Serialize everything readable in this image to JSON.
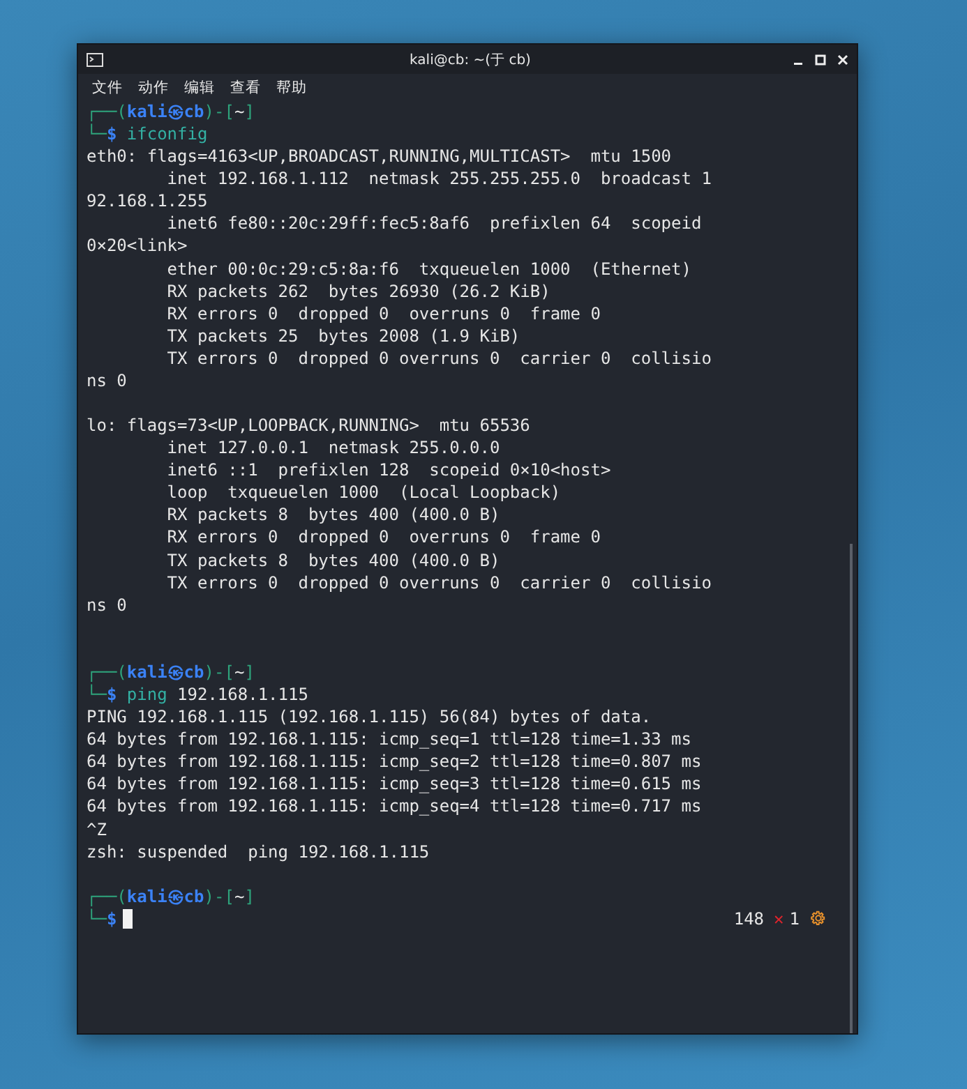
{
  "window": {
    "title": "kali@cb: ~(于 cb)"
  },
  "menu": [
    {
      "label": "文件"
    },
    {
      "label": "动作"
    },
    {
      "label": "编辑"
    },
    {
      "label": "查看"
    },
    {
      "label": "帮助"
    }
  ],
  "terminal": {
    "lines": [
      {
        "kind": "prompt",
        "segments": [
          {
            "kind": "frame",
            "text": "┌──("
          },
          {
            "kind": "user",
            "text": "kali㉿cb"
          },
          {
            "kind": "frame",
            "text": ")-["
          },
          {
            "kind": "plain",
            "text": "~"
          },
          {
            "kind": "frame",
            "text": "]"
          }
        ]
      },
      {
        "kind": "prompt",
        "segments": [
          {
            "kind": "frame",
            "text": "└─"
          },
          {
            "kind": "user",
            "text": "$"
          },
          {
            "kind": "command",
            "text": "ifconfig"
          }
        ]
      },
      {
        "kind": "output",
        "text": "eth0: flags=4163<UP,BROADCAST,RUNNING,MULTICAST>  mtu 1500"
      },
      {
        "kind": "output",
        "text": "        inet 192.168.1.112  netmask 255.255.255.0  broadcast 1"
      },
      {
        "kind": "output",
        "text": "92.168.1.255"
      },
      {
        "kind": "output",
        "text": "        inet6 fe80::20c:29ff:fec5:8af6  prefixlen 64  scopeid"
      },
      {
        "kind": "output",
        "text": "0×20<link>"
      },
      {
        "kind": "output",
        "text": "        ether 00:0c:29:c5:8a:f6  txqueuelen 1000  (Ethernet)"
      },
      {
        "kind": "output",
        "text": "        RX packets 262  bytes 26930 (26.2 KiB)"
      },
      {
        "kind": "output",
        "text": "        RX errors 0  dropped 0  overruns 0  frame 0"
      },
      {
        "kind": "output",
        "text": "        TX packets 25  bytes 2008 (1.9 KiB)"
      },
      {
        "kind": "output",
        "text": "        TX errors 0  dropped 0 overruns 0  carrier 0  collisio"
      },
      {
        "kind": "output",
        "text": "ns 0"
      },
      {
        "kind": "blank"
      },
      {
        "kind": "output",
        "text": "lo: flags=73<UP,LOOPBACK,RUNNING>  mtu 65536"
      },
      {
        "kind": "output",
        "text": "        inet 127.0.0.1  netmask 255.0.0.0"
      },
      {
        "kind": "output",
        "text": "        inet6 ::1  prefixlen 128  scopeid 0×10<host>"
      },
      {
        "kind": "output",
        "text": "        loop  txqueuelen 1000  (Local Loopback)"
      },
      {
        "kind": "output",
        "text": "        RX packets 8  bytes 400 (400.0 B)"
      },
      {
        "kind": "output",
        "text": "        RX errors 0  dropped 0  overruns 0  frame 0"
      },
      {
        "kind": "output",
        "text": "        TX packets 8  bytes 400 (400.0 B)"
      },
      {
        "kind": "output",
        "text": "        TX errors 0  dropped 0 overruns 0  carrier 0  collisio"
      },
      {
        "kind": "output",
        "text": "ns 0"
      },
      {
        "kind": "blank"
      },
      {
        "kind": "blank"
      },
      {
        "kind": "prompt",
        "segments": [
          {
            "kind": "frame",
            "text": "┌──("
          },
          {
            "kind": "user",
            "text": "kali㉿cb"
          },
          {
            "kind": "frame",
            "text": ")-["
          },
          {
            "kind": "plain",
            "text": "~"
          },
          {
            "kind": "frame",
            "text": "]"
          }
        ]
      },
      {
        "kind": "prompt",
        "segments": [
          {
            "kind": "frame",
            "text": "└─"
          },
          {
            "kind": "user",
            "text": "$"
          },
          {
            "kind": "command",
            "text": "ping"
          },
          {
            "kind": "arg",
            "text": "192.168.1.115"
          }
        ]
      },
      {
        "kind": "output",
        "text": "PING 192.168.1.115 (192.168.1.115) 56(84) bytes of data."
      },
      {
        "kind": "output",
        "text": "64 bytes from 192.168.1.115: icmp_seq=1 ttl=128 time=1.33 ms"
      },
      {
        "kind": "output",
        "text": "64 bytes from 192.168.1.115: icmp_seq=2 ttl=128 time=0.807 ms"
      },
      {
        "kind": "output",
        "text": "64 bytes from 192.168.1.115: icmp_seq=3 ttl=128 time=0.615 ms"
      },
      {
        "kind": "output",
        "text": "64 bytes from 192.168.1.115: icmp_seq=4 ttl=128 time=0.717 ms"
      },
      {
        "kind": "output",
        "text": "^Z"
      },
      {
        "kind": "output",
        "text": "zsh: suspended  ping 192.168.1.115"
      },
      {
        "kind": "blank"
      },
      {
        "kind": "prompt",
        "segments": [
          {
            "kind": "frame",
            "text": "┌──("
          },
          {
            "kind": "user",
            "text": "kali㉿cb"
          },
          {
            "kind": "frame",
            "text": ")-["
          },
          {
            "kind": "plain",
            "text": "~"
          },
          {
            "kind": "frame",
            "text": "]"
          }
        ]
      },
      {
        "kind": "input",
        "segments": [
          {
            "kind": "frame",
            "text": "└─"
          },
          {
            "kind": "user",
            "text": "$"
          }
        ],
        "status": {
          "history": "148",
          "error_mark": "✕",
          "exit_code": "1"
        }
      }
    ]
  }
}
